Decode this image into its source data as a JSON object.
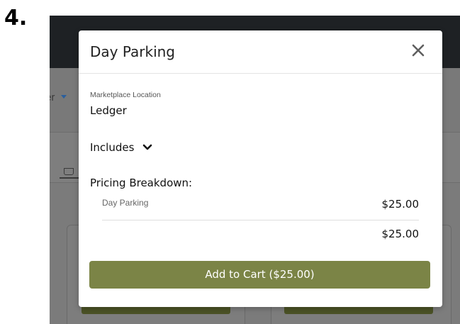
{
  "step_number": "4.",
  "background": {
    "dropdown_text": "er"
  },
  "modal": {
    "title": "Day Parking",
    "close_icon": "close-icon",
    "location_label": "Marketplace Location",
    "location_value": "Ledger",
    "includes_label": "Includes",
    "includes_icon": "chevron-down-icon",
    "pricing_title": "Pricing Breakdown:",
    "line_items": [
      {
        "name": "Day Parking",
        "price": "$25.00"
      }
    ],
    "total": "$25.00",
    "add_button_label": "Add to Cart ($25.00)",
    "accent_color": "#7b8446"
  }
}
